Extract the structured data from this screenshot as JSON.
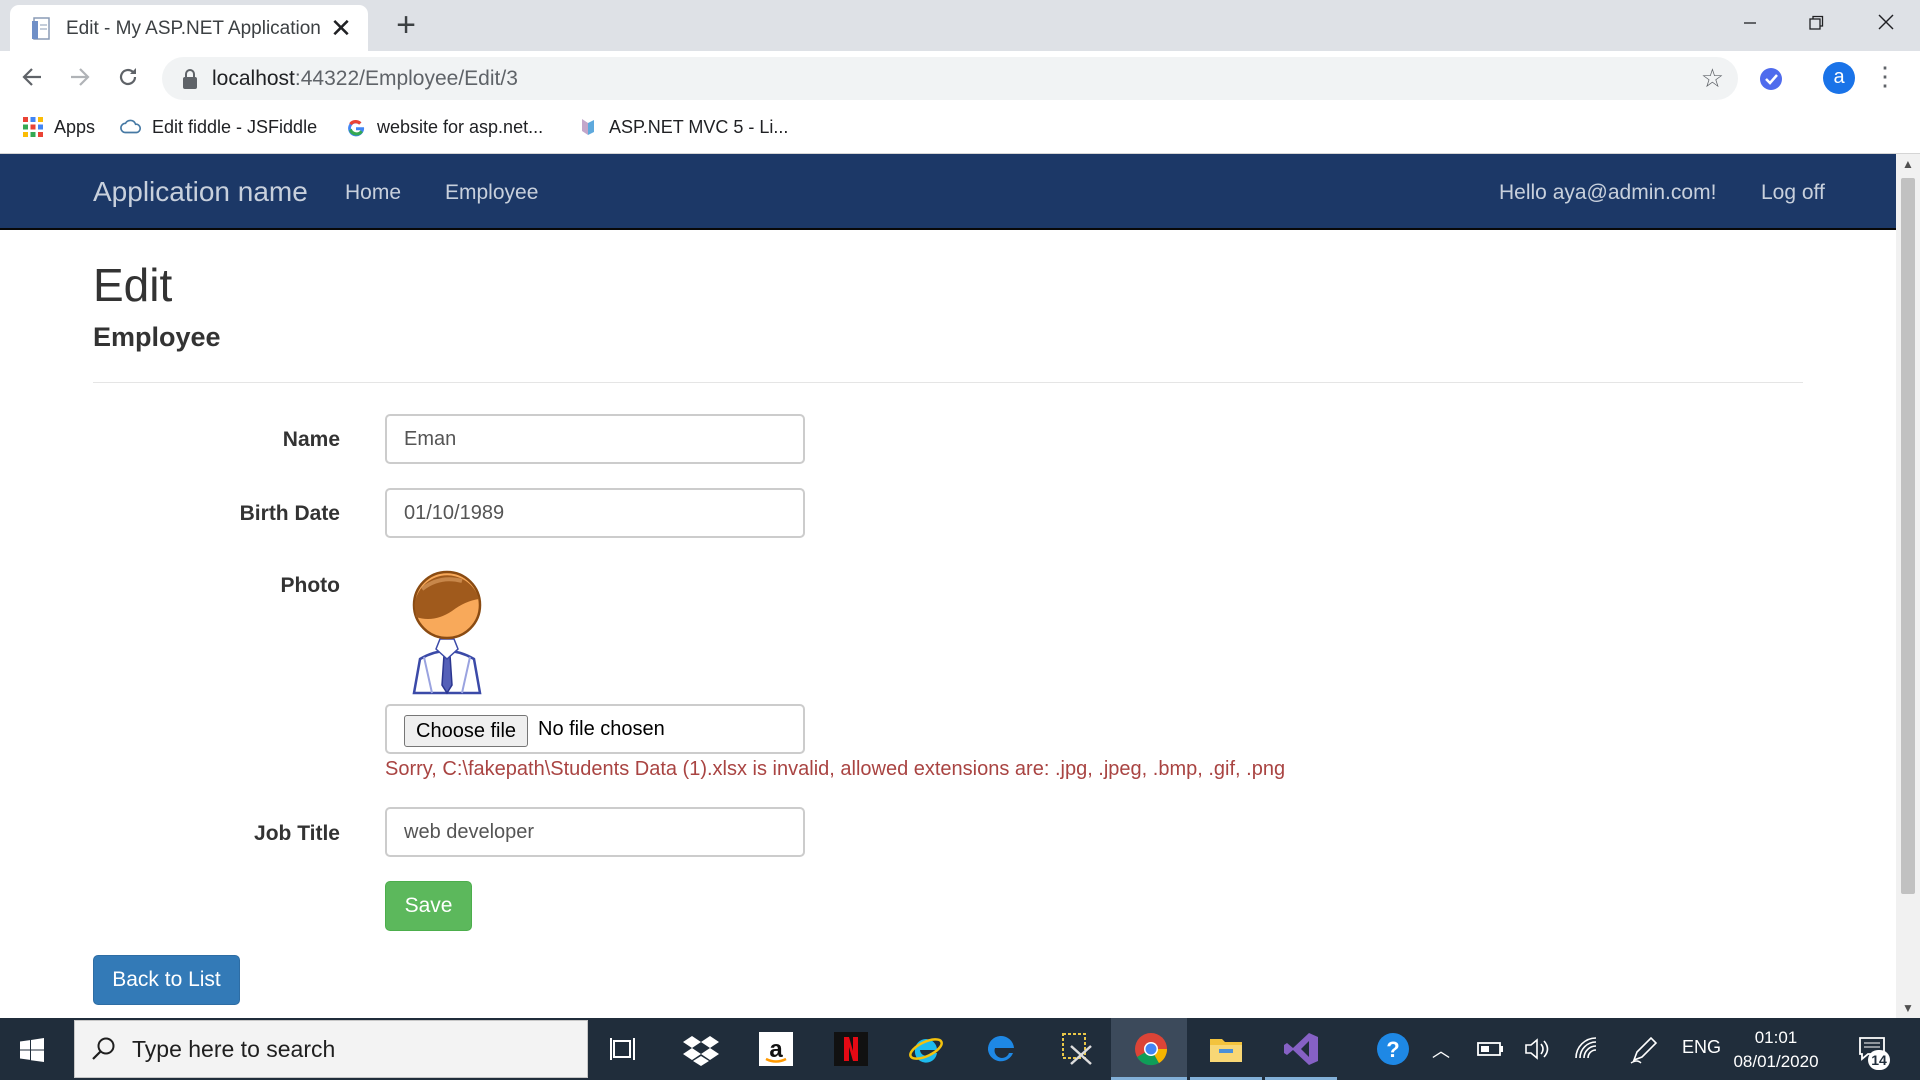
{
  "browser": {
    "tab_title": "Edit - My ASP.NET Application",
    "tab_close": "✕",
    "new_tab": "+",
    "url_host": "localhost",
    "url_rest": ":44322/Employee/Edit/3",
    "profile_initial": "a",
    "bookmarks": [
      {
        "label": "Apps",
        "icon": "apps-grid-icon"
      },
      {
        "label": "Edit fiddle - JSFiddle",
        "icon": "jsfiddle-cloud-icon"
      },
      {
        "label": "website for asp.net...",
        "icon": "google-g-icon"
      },
      {
        "label": "ASP.NET MVC 5 - Li...",
        "icon": "aspnet-logo-icon"
      }
    ]
  },
  "navbar": {
    "brand": "Application name",
    "links": [
      "Home",
      "Employee"
    ],
    "greeting": "Hello aya@admin.com!",
    "logoff": "Log off",
    "bg_color": "#1c3867"
  },
  "page": {
    "title": "Edit",
    "subtitle": "Employee"
  },
  "form": {
    "name_label": "Name",
    "name_value": "Eman",
    "birthdate_label": "Birth Date",
    "birthdate_value": "01/10/1989",
    "photo_label": "Photo",
    "choose_file": "Choose file",
    "no_file": "No file chosen",
    "error": "Sorry, C:\\fakepath\\Students Data (1).xlsx is invalid, allowed extensions are: .jpg, .jpeg, .bmp, .gif, .png",
    "jobtitle_label": "Job Title",
    "jobtitle_value": "web developer",
    "save": "Save",
    "back": "Back to List",
    "error_color": "#a94442",
    "save_color": "#5cb85c",
    "back_color": "#337ab7"
  },
  "taskbar": {
    "search_placeholder": "Type here to search",
    "lang": "ENG",
    "time": "01:01",
    "date": "08/01/2020",
    "notifications": "14"
  }
}
